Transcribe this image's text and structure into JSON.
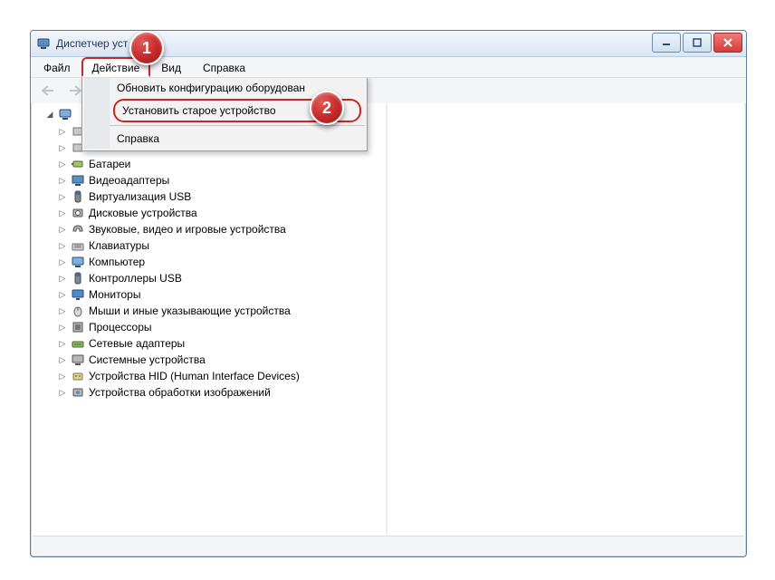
{
  "window": {
    "title": "Диспетчер уст"
  },
  "menubar": {
    "file": "Файл",
    "action": "Действие",
    "view": "Вид",
    "help": "Справка"
  },
  "dropdown": {
    "refresh": "Обновить конфигурацию оборудован",
    "legacy": "Установить старое устройство",
    "help": "Справка"
  },
  "callouts": {
    "one": "1",
    "two": "2"
  },
  "tree": {
    "root_hidden": "",
    "nodes": [
      {
        "label": "Батареи"
      },
      {
        "label": "Видеоадаптеры"
      },
      {
        "label": "Виртуализация USB"
      },
      {
        "label": "Дисковые устройства"
      },
      {
        "label": "Звуковые, видео и игровые устройства"
      },
      {
        "label": "Клавиатуры"
      },
      {
        "label": "Компьютер"
      },
      {
        "label": "Контроллеры USB"
      },
      {
        "label": "Мониторы"
      },
      {
        "label": "Мыши и иные указывающие устройства"
      },
      {
        "label": "Процессоры"
      },
      {
        "label": "Сетевые адаптеры"
      },
      {
        "label": "Системные устройства"
      },
      {
        "label": "Устройства HID (Human Interface Devices)"
      },
      {
        "label": "Устройства обработки изображений"
      }
    ]
  }
}
